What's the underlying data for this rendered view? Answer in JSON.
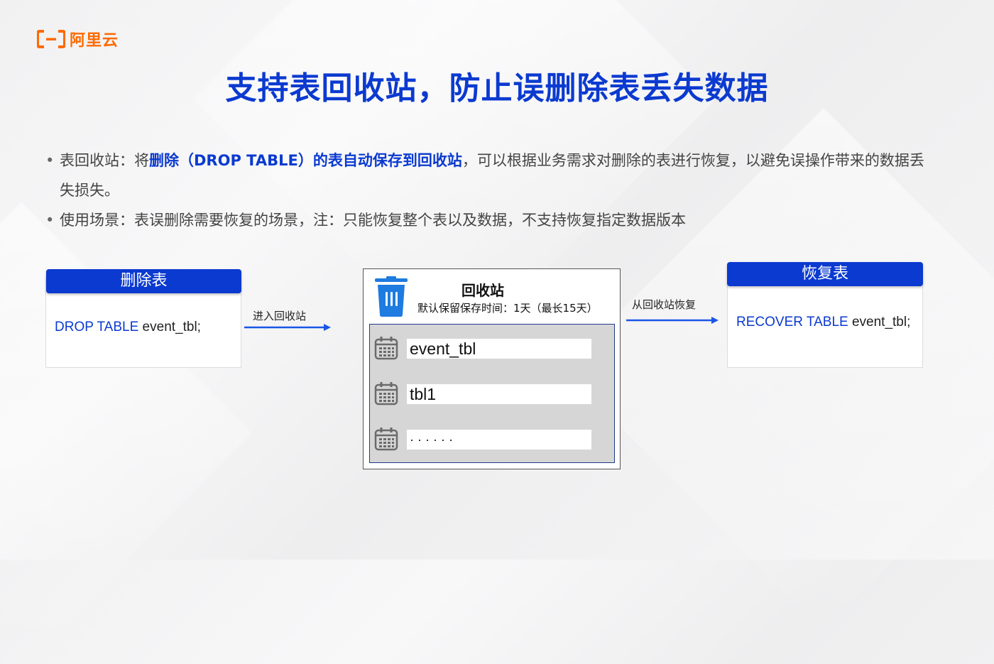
{
  "logo": {
    "text": "阿里云",
    "color": "#ff6a00"
  },
  "title": "支持表回收站，防止误删除表丢失数据",
  "bullets": [
    {
      "pre": "表回收站：将",
      "highlight": "删除（DROP TABLE）的表自动保存到回收站",
      "post": "，可以根据业务需求对删除的表进行恢复，以避免误操作带来的数据丢失损失。"
    },
    {
      "pre": "使用场景：表误删除需要恢复的场景，注：只能恢复整个表以及数据，不支持恢复指定数据版本"
    }
  ],
  "drop_card": {
    "header": "删除表",
    "keyword": "DROP TABLE",
    "object": " event_tbl;"
  },
  "arrow_in": {
    "label": "进入回收站"
  },
  "recycle_bin": {
    "title": "回收站",
    "subtitle": "默认保留保存时间：1天（最长15天）",
    "items": [
      "event_tbl",
      "tbl1",
      "· · · · · ·"
    ]
  },
  "arrow_out": {
    "label": "从回收站恢复"
  },
  "recover_card": {
    "header": "恢复表",
    "keyword": "RECOVER TABLE",
    "object": " event_tbl;"
  },
  "colors": {
    "accent": "#0b3ad0",
    "brand": "#ff6a00",
    "arrow": "#1a56e6",
    "bin_icon": "#1e7be0"
  }
}
